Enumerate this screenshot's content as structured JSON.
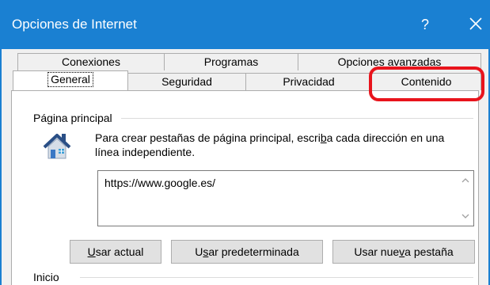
{
  "window": {
    "title": "Opciones de Internet",
    "help_label": "?",
    "accent_color": "#1a80d2"
  },
  "tabs": {
    "row_top": [
      {
        "label": "Conexiones"
      },
      {
        "label": "Programas"
      },
      {
        "label": "Opciones avanzadas"
      }
    ],
    "row_bottom": [
      {
        "label": "General",
        "active": true
      },
      {
        "label": "Seguridad"
      },
      {
        "label": "Privacidad"
      },
      {
        "label": "Contenido",
        "highlighted": true
      }
    ]
  },
  "home_page": {
    "group_title": "Página principal",
    "description_pre": "Para crear pestañas de página principal, escri",
    "description_underlined": "b",
    "description_post": "a cada dirección en una línea independiente.",
    "url_value": "https://www.google.es/",
    "icon": "house-icon"
  },
  "buttons": {
    "use_current": {
      "pre": "",
      "mnemonic": "U",
      "post": "sar actual"
    },
    "use_default": {
      "pre": "U",
      "mnemonic": "s",
      "post": "ar predeterminada"
    },
    "use_new_tab": {
      "pre": "Usar nue",
      "mnemonic": "v",
      "post": "a pestaña"
    }
  },
  "startup": {
    "group_title": "Inicio"
  },
  "annotation": {
    "highlight_color": "#e8141c"
  }
}
